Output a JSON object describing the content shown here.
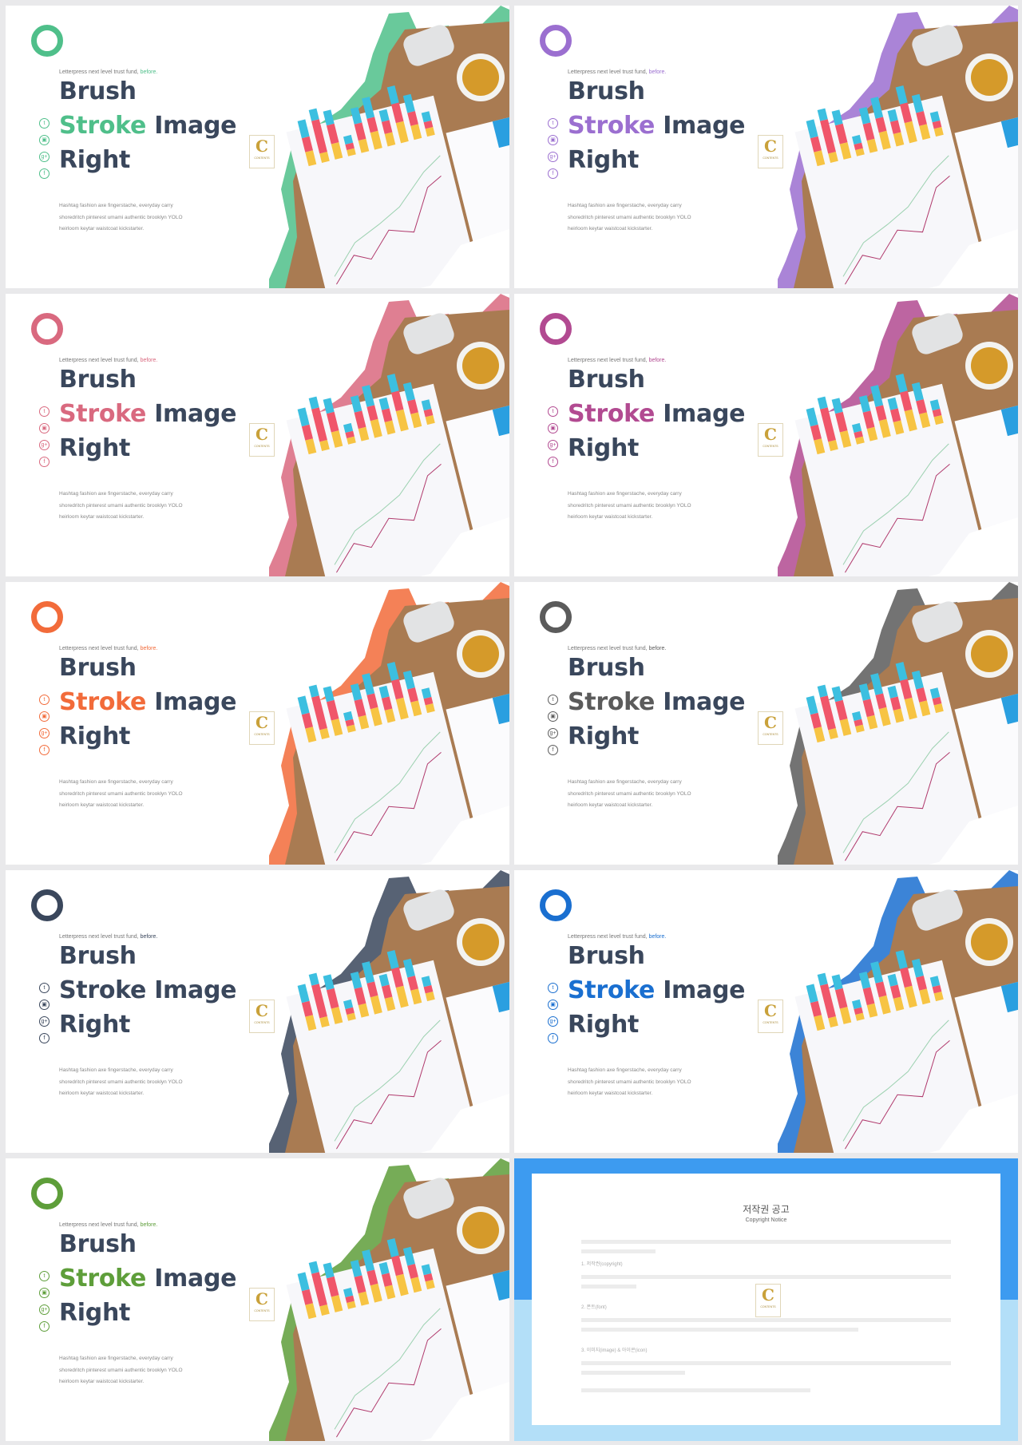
{
  "slide_template": {
    "tagline": "Letterpress next level trust fund,",
    "tagline_accent": "before.",
    "title_line1": "Brush",
    "title_accent": "Stroke",
    "title_rest": " Image",
    "title_line3": "Right",
    "body_lines": [
      "Hashtag fashion axe fingerstache, everyday carry",
      "shoredritch pinterest umami authentic brooklyn YOLO",
      "heirloom  keytar waistcoat kickstarter."
    ],
    "social_icons": [
      "twitter-icon",
      "youtube-icon",
      "google-plus-icon",
      "facebook-icon"
    ],
    "social_glyphs": [
      "t",
      "▣",
      "g+",
      "f"
    ],
    "logo_letter": "C",
    "logo_text": "CONTENTS"
  },
  "slides": [
    {
      "accent": "#4fbf8a"
    },
    {
      "accent": "#9b6fd0"
    },
    {
      "accent": "#d9697f"
    },
    {
      "accent": "#b24a91"
    },
    {
      "accent": "#f26b3a"
    },
    {
      "accent": "#5b5b5b"
    },
    {
      "accent": "#3a475c"
    },
    {
      "accent": "#1a6fd0"
    },
    {
      "accent": "#5e9e3a"
    }
  ],
  "copyright": {
    "title": "저작권 공고",
    "subtitle": "Copyright Notice",
    "sections": [
      "1. 저작권(copyright)",
      "2. 폰트(font)",
      "3. 이미지(image) & 아이콘(icon)"
    ],
    "colors": {
      "top": "#3d9bf0",
      "bottom": "#b3dff8"
    }
  }
}
